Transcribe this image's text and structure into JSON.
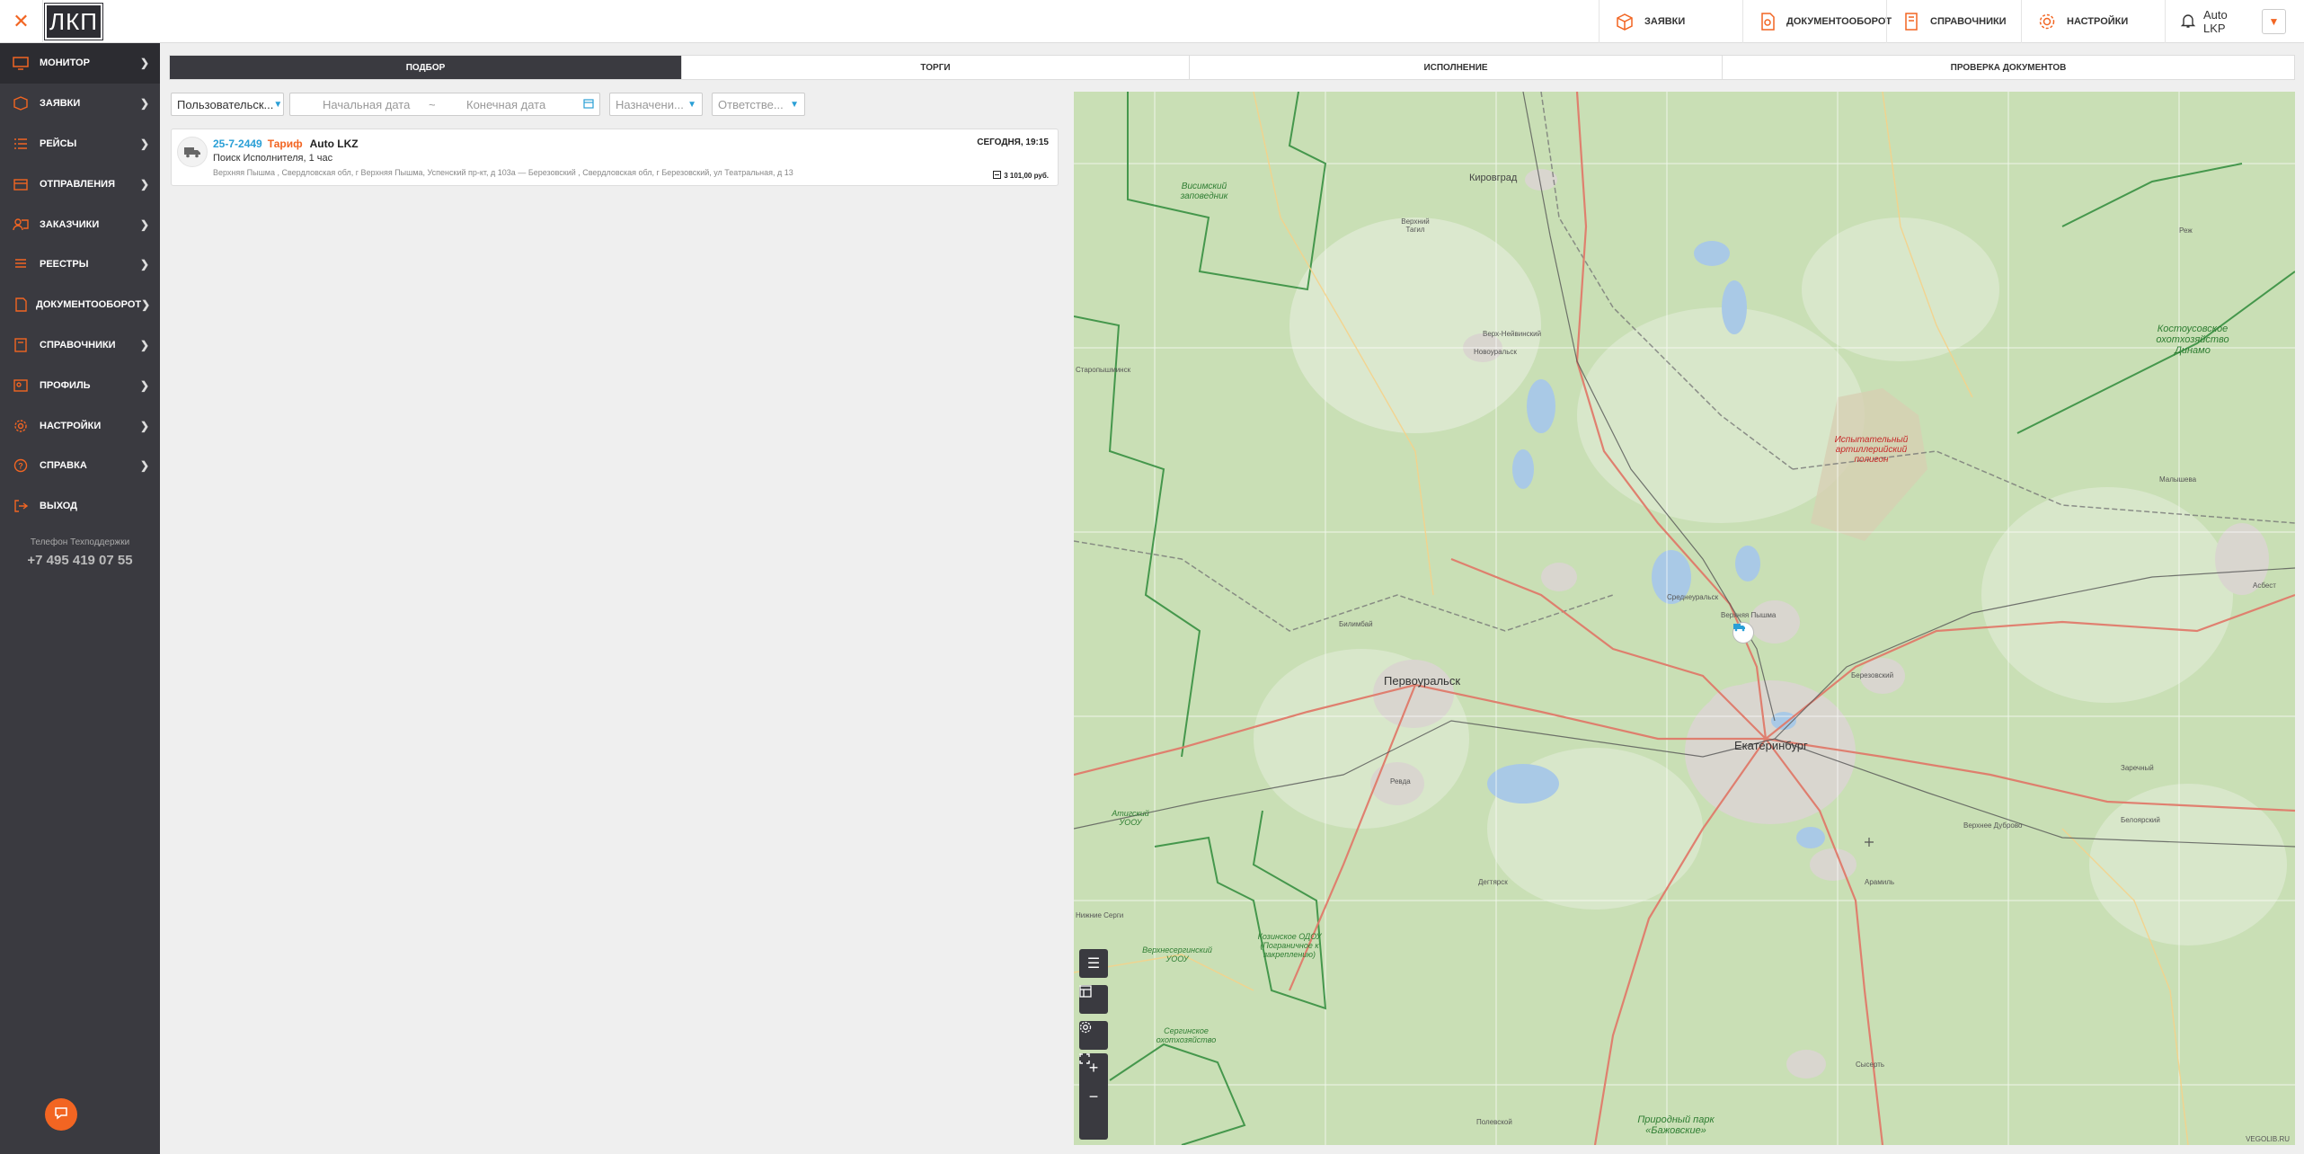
{
  "topbar": {
    "logo": "ЛКП",
    "nav": [
      {
        "label": "Заявки",
        "icon": "box-icon"
      },
      {
        "label": "Документооборот",
        "icon": "document-icon"
      },
      {
        "label": "Справочники",
        "icon": "book-icon"
      },
      {
        "label": "Настройки",
        "icon": "gear-icon"
      }
    ],
    "user_name": "Auto LKP"
  },
  "sidebar": {
    "items": [
      {
        "label": "Монитор",
        "icon": "monitor-icon"
      },
      {
        "label": "Заявки",
        "icon": "box-icon"
      },
      {
        "label": "Рейсы",
        "icon": "list-icon"
      },
      {
        "label": "Отправления",
        "icon": "dispatch-icon"
      },
      {
        "label": "Заказчики",
        "icon": "customers-icon"
      },
      {
        "label": "Реестры",
        "icon": "registry-icon"
      },
      {
        "label": "Документооборот",
        "icon": "document-icon"
      },
      {
        "label": "Справочники",
        "icon": "book-icon"
      },
      {
        "label": "Профиль",
        "icon": "profile-icon"
      },
      {
        "label": "Настройки",
        "icon": "gear-icon"
      },
      {
        "label": "Справка",
        "icon": "help-icon"
      },
      {
        "label": "Выход",
        "icon": "logout-icon"
      }
    ],
    "support_label": "Телефон Техподдержки",
    "support_phone": "+7 495 419 07 55"
  },
  "tabs": [
    {
      "label": "Подбор",
      "active": true
    },
    {
      "label": "Торги",
      "active": false
    },
    {
      "label": "Исполнение",
      "active": false
    },
    {
      "label": "Проверка документов",
      "active": false
    }
  ],
  "filters": {
    "user_value": "Пользовательск...",
    "start_date_placeholder": "Начальная дата",
    "date_separator": "~",
    "end_date_placeholder": "Конечная дата",
    "destination_placeholder": "Назначени...",
    "responsible_placeholder": "Ответстве..."
  },
  "card": {
    "number": "25-7-2449",
    "tariff": "Тариф",
    "company": "Auto LKZ",
    "time": "Сегодня, 19:15",
    "status": "Поиск Исполнителя, 1 час",
    "route": "Верхняя Пышма , Свердловская обл, г Верхняя Пышма, Успенский пр-кт, д 103а  —  Березовский , Свердловская обл, г Березовский, ул Театральная, д 13",
    "price": "3 101,00 руб."
  },
  "map": {
    "labels": {
      "kirovgrad": "Кировград",
      "verkhny_tagil": "Верхний Тагил",
      "verkh_neyvinsky": "Верх-Нейвинский",
      "novouralsk": "Новоуральск",
      "visimsky": "Висимский заповедник",
      "pervouralsk": "Первоуральск",
      "bilimbay": "Билимбай",
      "srednyuralsk": "Среднеуральск",
      "verkhnyaya_pyshma": "Верхняя Пышма",
      "berezovsky": "Березовский",
      "ekaterinburg": "Екатеринбург",
      "revda": "Ревда",
      "aramil": "Арамиль",
      "degtyarsk": "Дегтярск",
      "polevskoy": "Полевской",
      "sysert": "Сысерть",
      "rezh": "Реж",
      "asbest": "Асбест",
      "malyshewa": "Малышева",
      "zarechny": "Заречный",
      "beloyarsky": "Белоярский",
      "verkhneye_dubrovo": "Верхнее Дуброво",
      "kostousovskoe": "Костоусовское охотхозяйство Динамо",
      "test_range": "Испытательный артиллерийский полигон",
      "atigsky": "Атигский УООУ",
      "verkhnesergi": "Верхнесергинский УООУ",
      "kozinskoe": "Козинское ОДОУ (Пограничное к закреплению)",
      "serginskoe": "Сергинское охотхозяйство",
      "bazhovskie": "Природный парк «Бажовские»",
      "nizhnie_sergi": "Нижние Серги",
      "staropyshminsk": "Старопышминск",
      "credit": "VEGOLIB.RU"
    }
  },
  "colors": {
    "accent": "#f26522",
    "link": "#2a9fd6",
    "sidebar_bg": "#3a3a40",
    "map_bg": "#c9dfb5"
  }
}
